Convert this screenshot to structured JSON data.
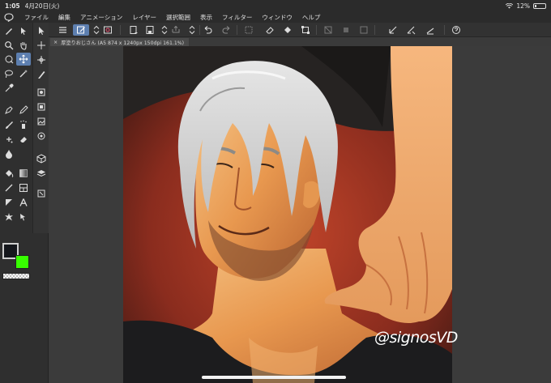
{
  "status_bar": {
    "time": "1:05",
    "date": "4月20日(火)",
    "battery": "12%",
    "battery_level": 0.12
  },
  "menu": {
    "items": [
      "ファイル",
      "編集",
      "アニメーション",
      "レイヤー",
      "選択範囲",
      "表示",
      "フィルター",
      "ウィンドウ",
      "ヘルプ"
    ]
  },
  "document": {
    "tab_label": "厚塗りおじさん (A5 874 x 1240px 150dpi 161.1%)"
  },
  "colors": {
    "main": "#15171c",
    "sub": "#37ff00",
    "accent": "#5d7fb0"
  },
  "artwork": {
    "signature": "@signosVD"
  },
  "icons": {
    "menu_logo": "clip-studio-logo-icon",
    "wifi": "wifi-icon",
    "battery": "battery-icon"
  }
}
